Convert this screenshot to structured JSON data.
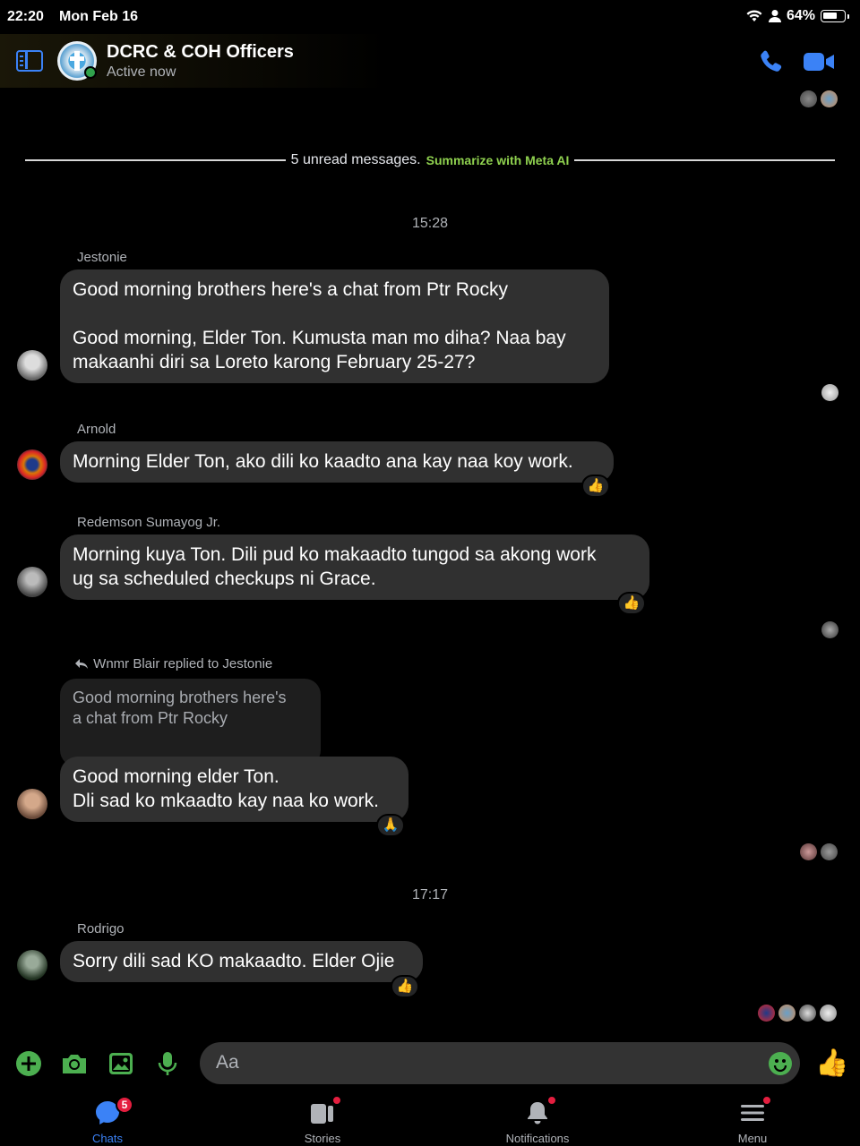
{
  "status_bar": {
    "time": "22:20",
    "date": "Mon Feb 16",
    "battery": "64%"
  },
  "header": {
    "title": "DCRC & COH Officers",
    "status": "Active now"
  },
  "unread": {
    "text": "5 unread messages.",
    "summarize": "Summarize with Meta AI"
  },
  "timestamps": [
    "15:28",
    "17:17"
  ],
  "messages": [
    {
      "sender": "Jestonie",
      "text": "Good morning brothers here's a chat from Ptr Rocky\n\nGood morning, Elder Ton. Kumusta man mo diha? Naa bay\nmakaanhi diri sa Loreto karong February 25-27?",
      "reaction": ""
    },
    {
      "sender": "Arnold",
      "text": "Morning Elder Ton, ako dili ko kaadto ana kay naa koy work.",
      "reaction": "👍"
    },
    {
      "sender": "Redemson Sumayog Jr.",
      "text": "Morning kuya Ton. Dili pud ko makaadto tungod sa akong work\nug sa scheduled checkups ni Grace.",
      "reaction": "👍"
    },
    {
      "sender": "Wnmr Blair replied to Jestonie",
      "quoted": "Good morning brothers here's\na chat from Ptr Rocky",
      "text": "Good morning elder Ton.\nDli sad ko mkaadto kay naa ko work.",
      "reaction": "🙏"
    },
    {
      "sender": "Rodrigo",
      "text": "Sorry dili sad KO makaadto. Elder Ojie",
      "reaction": "👍"
    }
  ],
  "composer": {
    "placeholder": "Aa"
  },
  "tabs": [
    {
      "label": "Chats",
      "badge": "5"
    },
    {
      "label": "Stories"
    },
    {
      "label": "Notifications"
    },
    {
      "label": "Menu"
    }
  ],
  "colors": {
    "accent": "#3b82f6",
    "bubble": "#303030",
    "meta_ai": "#8fd14f",
    "badge": "#e41e3f",
    "compose_icons": "#4caf50"
  }
}
